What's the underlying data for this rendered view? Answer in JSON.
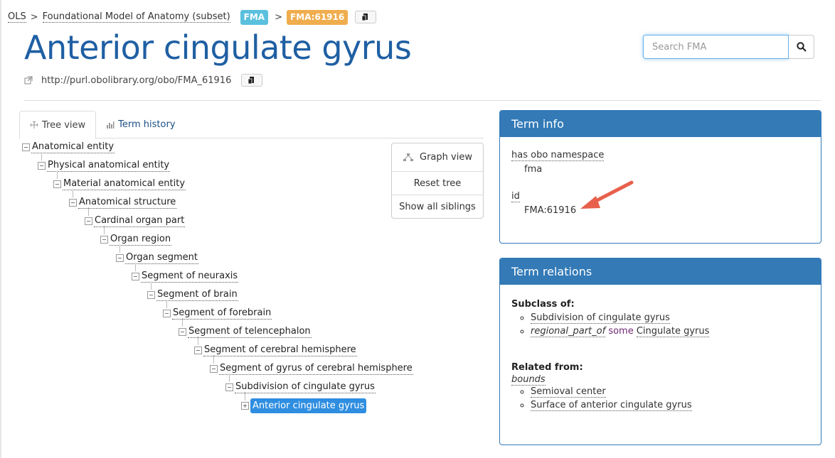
{
  "breadcrumb": {
    "root": "OLS",
    "ontology": "Foundational Model of Anatomy (subset)",
    "badge_ontology": "FMA",
    "badge_term": "FMA:61916",
    "sep": ">"
  },
  "term": {
    "title": "Anterior cingulate gyrus",
    "iri": "http://purl.obolibrary.org/obo/FMA_61916"
  },
  "search": {
    "placeholder": "Search FMA"
  },
  "tabs": [
    {
      "label": "Tree view",
      "active": true
    },
    {
      "label": "Term history",
      "active": false
    }
  ],
  "tree": [
    {
      "label": "Anatomical entity",
      "depth": 0
    },
    {
      "label": "Physical anatomical entity",
      "depth": 1
    },
    {
      "label": "Material anatomical entity",
      "depth": 2
    },
    {
      "label": "Anatomical structure",
      "depth": 3
    },
    {
      "label": "Cardinal organ part",
      "depth": 4
    },
    {
      "label": "Organ region",
      "depth": 5
    },
    {
      "label": "Organ segment",
      "depth": 6
    },
    {
      "label": "Segment of neuraxis",
      "depth": 7
    },
    {
      "label": "Segment of brain",
      "depth": 8
    },
    {
      "label": "Segment of forebrain",
      "depth": 9
    },
    {
      "label": "Segment of telencephalon",
      "depth": 10
    },
    {
      "label": "Segment of cerebral hemisphere",
      "depth": 11
    },
    {
      "label": "Segment of gyrus of cerebral hemisphere",
      "depth": 12
    },
    {
      "label": "Subdivision of cingulate gyrus",
      "depth": 13
    },
    {
      "label": "Anterior cingulate gyrus",
      "depth": 14,
      "selected": true
    }
  ],
  "graph_buttons": {
    "graph_view": "Graph view",
    "reset_tree": "Reset tree",
    "show_siblings": "Show all siblings"
  },
  "term_info": {
    "header": "Term info",
    "namespace_key": "has obo namespace",
    "namespace_val": "fma",
    "id_key": "id",
    "id_val": "FMA:61916"
  },
  "term_relations": {
    "header": "Term relations",
    "subclass_heading": "Subclass of:",
    "subclass_items": {
      "first": "Subdivision of cingulate gyrus",
      "property": "regional_part_of",
      "some": "some",
      "target": "Cingulate gyrus"
    },
    "related_heading": "Related from:",
    "related_property": "bounds",
    "related_items": [
      "Semioval center",
      "Surface of anterior cingulate gyrus"
    ]
  },
  "colors": {
    "title": "#1f5fa3",
    "panel_header": "#337ab7",
    "badge_ontology": "#5bc0de",
    "badge_term": "#f0ad4e",
    "selected_node": "#2f8ee0",
    "arrow": "#e8604c"
  }
}
